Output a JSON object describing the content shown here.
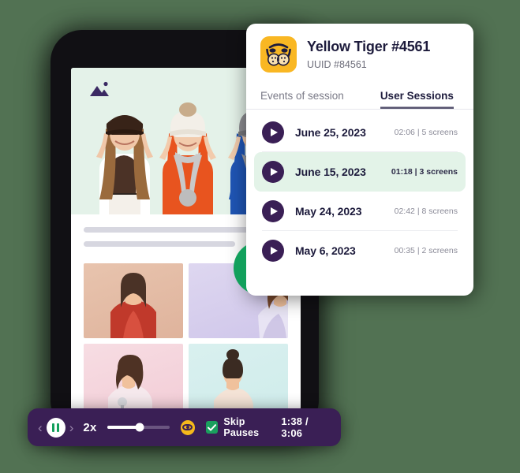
{
  "background_color": "#527253",
  "session_card": {
    "avatar_icon": "tiger-face-emoji",
    "avatar_bg": "#f9b723",
    "title": "Yellow Tiger #4561",
    "subtitle": "UUID #84561",
    "tabs": [
      {
        "label": "Events of session",
        "active": false
      },
      {
        "label": "User Sessions",
        "active": true
      }
    ],
    "sessions": [
      {
        "play_icon": "play-icon",
        "date": "June 25, 2023",
        "duration": "02:06",
        "screens": "5 screens",
        "meta": "02:06 | 5 screens",
        "active": false
      },
      {
        "play_icon": "play-icon",
        "date": "June 15, 2023",
        "duration": "01:18",
        "screens": "3 screens",
        "meta": "01:18 | 3 screens",
        "active": true
      },
      {
        "play_icon": "play-icon",
        "date": "May 24, 2023",
        "duration": "02:42",
        "screens": "8 screens",
        "meta": "02:42 | 8 screens",
        "active": false
      },
      {
        "play_icon": "play-icon",
        "date": "May 6, 2023",
        "duration": "00:35",
        "screens": "2 screens",
        "meta": "00:35 | 2 screens",
        "active": false
      }
    ]
  },
  "tablet": {
    "hero_icon": "image-placeholder-icon",
    "search_icon": "search-icon",
    "play_overlay_icon": "play-icon",
    "play_overlay_color": "#12a05c"
  },
  "player_bar": {
    "bg_color": "#3a1f55",
    "prev_icon": "chevron-left-icon",
    "next_icon": "chevron-right-icon",
    "prev_label": "‹",
    "next_label": "›",
    "pause_icon": "pause-icon",
    "speed": "2x",
    "volume_icon": "volume-slider",
    "volume_percent": 52,
    "eye_icon": "eye-icon",
    "eye_color": "#f5b81b",
    "skip_checkbox_icon": "checkmark-icon",
    "skip_checkbox_checked": true,
    "skip_checkbox_color": "#1aa05e",
    "skip_label": "Skip Pauses",
    "timecode": "1:38 / 3:06"
  }
}
